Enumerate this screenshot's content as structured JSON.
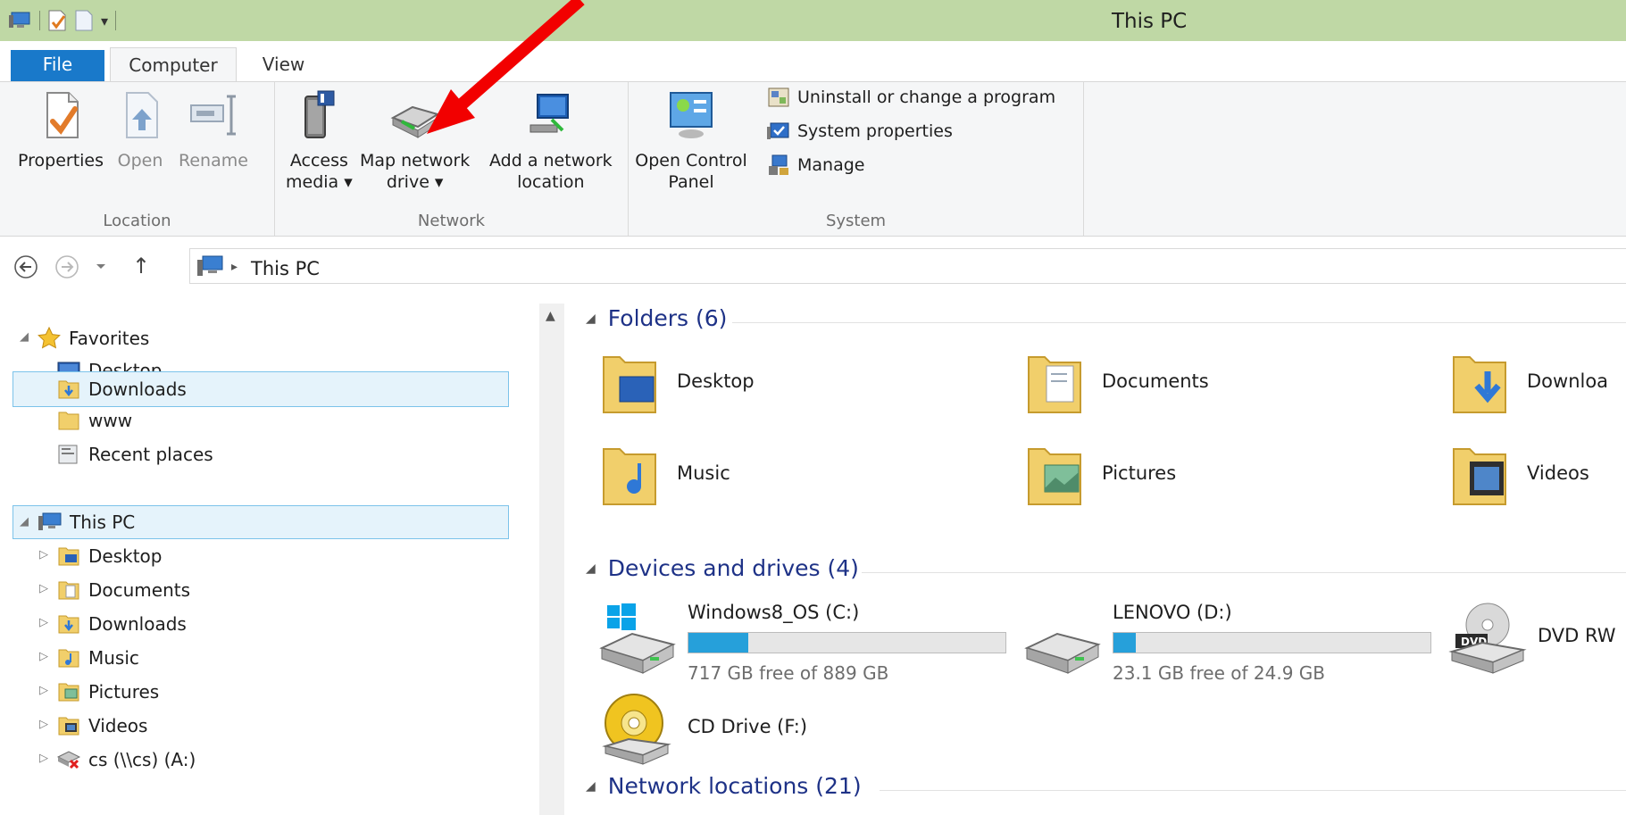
{
  "window": {
    "title": "This PC"
  },
  "qat": {
    "icons": [
      "computer-icon",
      "properties-icon",
      "new-folder-icon",
      "customize-down-icon"
    ]
  },
  "ribbon": {
    "tabs": {
      "file": "File",
      "computer": "Computer",
      "view": "View"
    },
    "location": {
      "label": "Location",
      "properties": "Properties",
      "open": "Open",
      "rename": "Rename"
    },
    "network": {
      "label": "Network",
      "access_media_line1": "Access",
      "access_media_line2": "media ▾",
      "map_drive_line1": "Map network",
      "map_drive_line2": "drive ▾",
      "add_location_line1": "Add a network",
      "add_location_line2": "location"
    },
    "system": {
      "label": "System",
      "control_panel_line1": "Open Control",
      "control_panel_line2": "Panel",
      "uninstall": "Uninstall or change a program",
      "system_properties": "System properties",
      "manage": "Manage"
    }
  },
  "address": {
    "crumb": "This PC"
  },
  "navpane": {
    "favorites": {
      "label": "Favorites",
      "items": [
        "Desktop",
        "Downloads",
        "www",
        "Recent places"
      ]
    },
    "this_pc": {
      "label": "This PC",
      "items": [
        "Desktop",
        "Documents",
        "Downloads",
        "Music",
        "Pictures",
        "Videos",
        "cs (\\\\cs) (A:)"
      ]
    }
  },
  "content": {
    "folders_header": "Folders (6)",
    "folders": [
      "Desktop",
      "Documents",
      "Downloa",
      "Music",
      "Pictures",
      "Videos"
    ],
    "devices_header": "Devices and drives (4)",
    "drives": [
      {
        "name": "Windows8_OS (C:)",
        "free": "717 GB free of 889 GB",
        "used_fraction": 0.19
      },
      {
        "name": "LENOVO (D:)",
        "free": "23.1 GB free of 24.9 GB",
        "used_fraction": 0.07
      },
      {
        "name": "DVD RW"
      },
      {
        "name": "CD Drive (F:)"
      }
    ],
    "network_header": "Network locations (21)"
  },
  "colors": {
    "titlebar": "#bfd8a5",
    "file_tab": "#1979ca",
    "section_header": "#1e3287",
    "drive_fill": "#26a0da",
    "selection": "#e5f3fb",
    "annotation_arrow": "#f20000"
  }
}
